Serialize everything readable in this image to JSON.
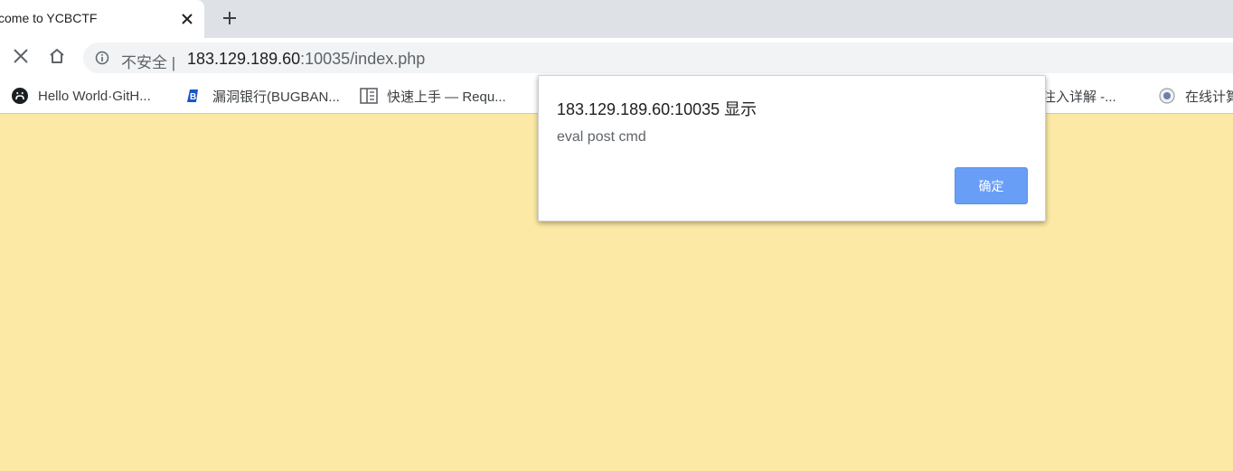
{
  "tab": {
    "title": "come to YCBCTF",
    "close_icon": "close-icon",
    "new_tab_icon": "plus-icon"
  },
  "toolbar": {
    "stop_icon": "close-icon",
    "home_icon": "home-icon",
    "security_icon": "info-icon",
    "security_label": "不安全 |",
    "url_host": "183.129.189.60",
    "url_rest": ":10035/index.php"
  },
  "bookmarks": [
    {
      "label": "Hello World·GitH...",
      "icon": "github-icon"
    },
    {
      "label": "漏洞银行(BUGBAN...",
      "icon": "bugbank-icon"
    },
    {
      "label": "快速上手 — Requ...",
      "icon": "book-icon"
    },
    {
      "label": "注入详解 -...",
      "icon": "bookmark-icon"
    },
    {
      "label": "在线计算",
      "icon": "calc-icon"
    }
  ],
  "dialog": {
    "title": "183.129.189.60:10035 显示",
    "message": "eval post cmd",
    "ok_label": "确定"
  },
  "colors": {
    "page_background": "#fbe9a5",
    "accent_button": "#699ef7"
  }
}
